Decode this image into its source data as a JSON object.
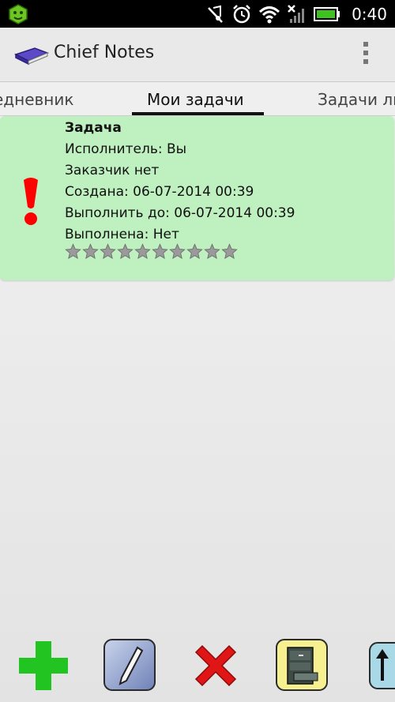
{
  "status_bar": {
    "time": "0:40"
  },
  "header": {
    "title": "Chief Notes"
  },
  "tabs": [
    {
      "label": "едневник"
    },
    {
      "label": "Мои задачи",
      "selected": true
    },
    {
      "label": "Задачи ли"
    }
  ],
  "task": {
    "title": "Задача",
    "assignee_label": "Исполнитель:",
    "assignee_value": "Вы",
    "customer_label": "Заказчик",
    "customer_value": "нет",
    "created_label": "Создана:",
    "created_value": "06-07-2014 00:39",
    "due_label": "Выполнить до:",
    "due_value": "06-07-2014 00:39",
    "done_label": "Выполнена:",
    "done_value": "Нет",
    "rating": 0,
    "rating_max": 10,
    "colors": {
      "card": "#bff0bf",
      "priority": "#ff0000"
    }
  },
  "toolbar": {
    "items": [
      {
        "icon": "add-icon"
      },
      {
        "icon": "edit-icon"
      },
      {
        "icon": "delete-icon"
      },
      {
        "icon": "archive-icon"
      },
      {
        "icon": "up-arrow-icon"
      }
    ]
  }
}
